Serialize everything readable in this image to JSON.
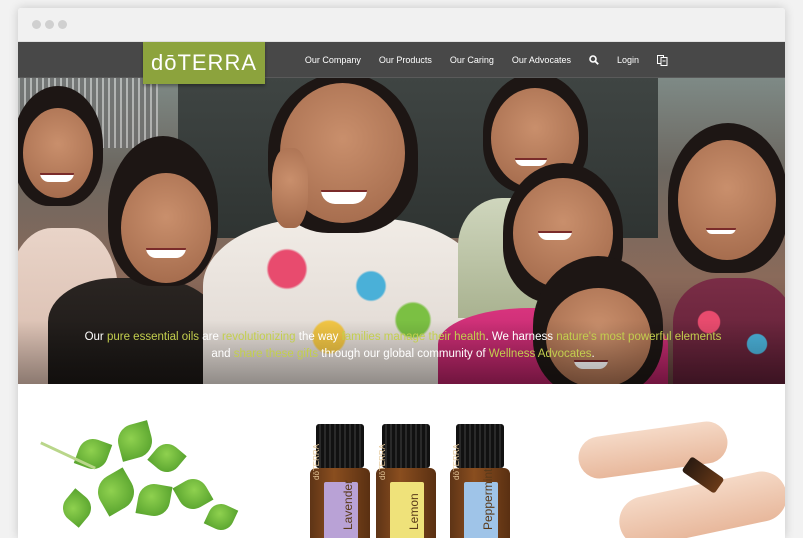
{
  "brand": {
    "logo_text": "dōTERRA",
    "accent": "#8ca33d"
  },
  "nav": {
    "items": [
      {
        "label": "Our Company"
      },
      {
        "label": "Our Products"
      },
      {
        "label": "Our Caring"
      },
      {
        "label": "Our Advocates"
      }
    ],
    "search_icon": "search-icon",
    "login_label": "Login",
    "language_icon": "language-icon"
  },
  "hero": {
    "caption": {
      "p1": "Our ",
      "h1": "pure essential oils",
      "p2": " are ",
      "h2": "revolutionizing",
      "p3": " the way ",
      "h3": "families manage their health",
      "p4": ". We harness ",
      "h4": "nature's most powerful elements",
      "p5": " and ",
      "h5": "share these gifts",
      "p6": " through our global community of ",
      "h6": "Wellness Advocates",
      "p7": "."
    },
    "highlight_color": "#c3cf4e"
  },
  "products": {
    "bottles": [
      {
        "brand": "dōTERRA",
        "name": "Lavender",
        "label_color": "#b9a2d6"
      },
      {
        "brand": "dōTERRA",
        "name": "Lemon",
        "label_color": "#efe27a"
      },
      {
        "brand": "dōTERRA",
        "name": "Peppermint",
        "label_color": "#9fc4e8"
      }
    ]
  }
}
